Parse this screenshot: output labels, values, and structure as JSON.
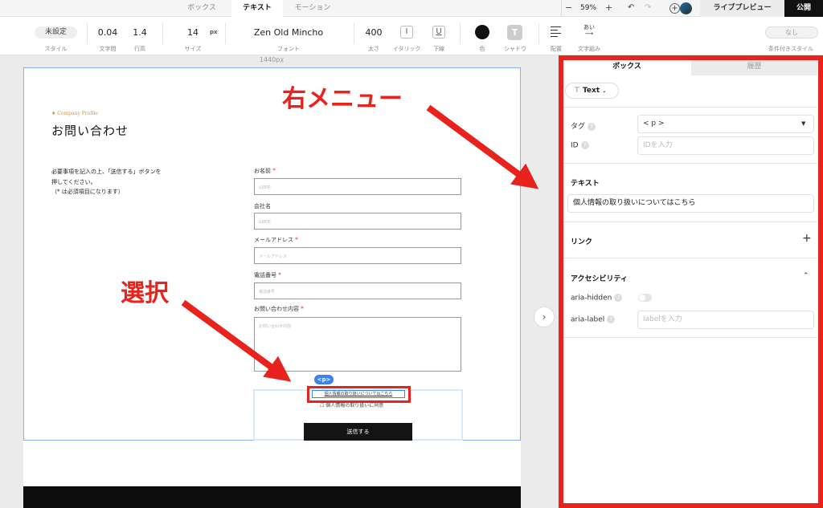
{
  "topbar": {
    "tabs": [
      {
        "label": "ボックス"
      },
      {
        "label": "テキスト"
      },
      {
        "label": "モーション"
      }
    ],
    "zoom": "59%",
    "zoom_minus": "−",
    "zoom_plus": "+",
    "live_preview": "ライブプレビュー",
    "publish": "公開"
  },
  "toolbar": {
    "style_value": "未設定",
    "style_label": "スタイル",
    "letter_spacing": "0.04",
    "letter_spacing_label": "文字間",
    "line_height": "1.4",
    "line_height_label": "行高",
    "size": "14",
    "size_unit": "px",
    "size_label": "サイズ",
    "font": "Zen Old Mincho",
    "font_label": "フォント",
    "weight": "400",
    "weight_label": "太さ",
    "italic_label": "イタリック",
    "underline_label": "下線",
    "color_label": "色",
    "color_value": "#111111",
    "shadow_label": "シャドウ",
    "align_label": "配置",
    "wrap_label": "文字組み",
    "wrap_icon_text": "あい",
    "conditional_value": "なし",
    "conditional_label": "条件付きスタイル"
  },
  "canvas": {
    "width_readout": "1440px",
    "page": {
      "eyebrow": "♦ Company Profile",
      "title": "お問い合わせ",
      "intro": [
        "必要事項を記入の上、「送信する」ボタンを",
        "押してください。",
        "（* は必須項目になります）"
      ],
      "fields": [
        {
          "label": "お名前",
          "required": true,
          "placeholder": "山田花"
        },
        {
          "label": "会社名",
          "required": false,
          "placeholder": "山田花"
        },
        {
          "label": "メールアドレス",
          "required": true,
          "placeholder": "メールアドレス"
        },
        {
          "label": "電話番号",
          "required": true,
          "placeholder": "電話番号"
        },
        {
          "label": "お問い合わせ内容",
          "required": true,
          "placeholder": "お問い合わせ内容"
        }
      ],
      "selected_tag": "<p>",
      "privacy_link": "個人情報の取り扱いについてはこちら",
      "agree_label": "個人情報の取り扱いに同意",
      "submit": "送信する"
    }
  },
  "annotations": {
    "right_menu": "右メニュー",
    "select": "選択"
  },
  "panel": {
    "tabs": [
      {
        "label": "ボックス"
      },
      {
        "label": "履歴"
      }
    ],
    "element_type": "Text",
    "tag_label": "タグ",
    "tag_value": "< p >",
    "id_label": "ID",
    "id_placeholder": "IDを入力",
    "text_section": "テキスト",
    "text_value": "個人情報の取り扱いについてはこちら",
    "link_section": "リンク",
    "a11y_section": "アクセシビリティ",
    "aria_hidden_label": "aria-hidden",
    "aria_label_label": "aria-label",
    "aria_label_placeholder": "labelを入力"
  }
}
